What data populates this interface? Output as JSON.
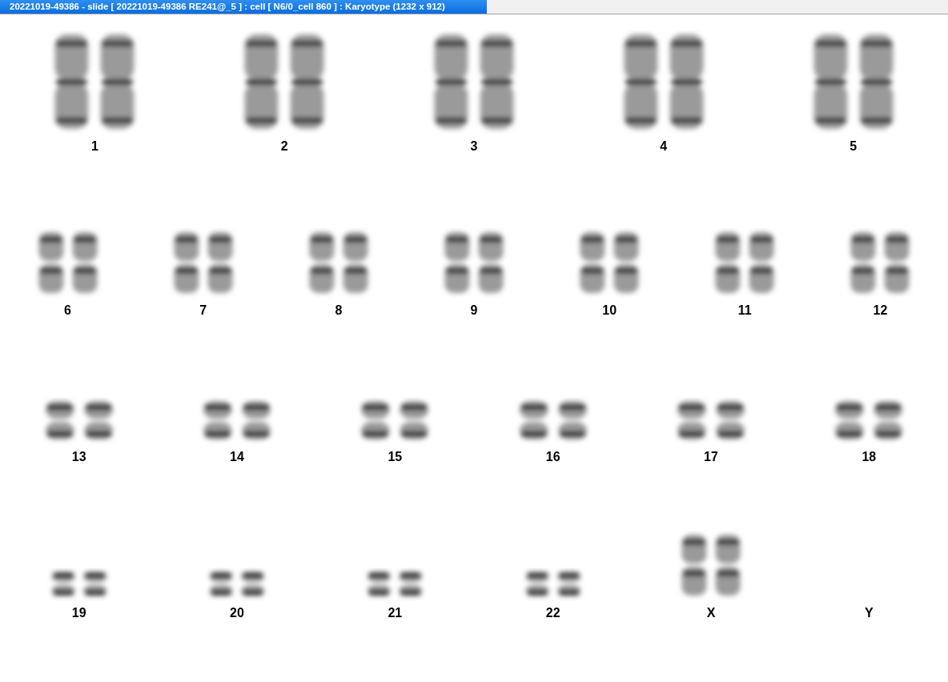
{
  "window": {
    "title": "20221019-49386 - slide [ 20221019-49386 RE241@_5 ] : cell [ N6/0_cell 860 ] : Karyotype  (1232 x 912)"
  },
  "karyotype_rows": [
    {
      "pairs": [
        {
          "label": "1",
          "kind": "large"
        },
        {
          "label": "2",
          "kind": "large"
        },
        {
          "label": "3",
          "kind": "large"
        },
        {
          "label": "4",
          "kind": "large"
        },
        {
          "label": "5",
          "kind": "large"
        }
      ]
    },
    {
      "pairs": [
        {
          "label": "6",
          "kind": "medium"
        },
        {
          "label": "7",
          "kind": "medium"
        },
        {
          "label": "8",
          "kind": "medium"
        },
        {
          "label": "9",
          "kind": "medium"
        },
        {
          "label": "10",
          "kind": "medium"
        },
        {
          "label": "11",
          "kind": "medium"
        },
        {
          "label": "12",
          "kind": "medium"
        }
      ]
    },
    {
      "pairs": [
        {
          "label": "13",
          "kind": "small"
        },
        {
          "label": "14",
          "kind": "small"
        },
        {
          "label": "15",
          "kind": "small"
        },
        {
          "label": "16",
          "kind": "small"
        },
        {
          "label": "17",
          "kind": "small"
        },
        {
          "label": "18",
          "kind": "small"
        }
      ]
    },
    {
      "pairs": [
        {
          "label": "19",
          "kind": "tiny"
        },
        {
          "label": "20",
          "kind": "tiny"
        },
        {
          "label": "21",
          "kind": "tiny"
        },
        {
          "label": "22",
          "kind": "tiny"
        },
        {
          "label": "X",
          "kind": "medium"
        },
        {
          "label": "Y",
          "kind": "none"
        }
      ]
    }
  ]
}
